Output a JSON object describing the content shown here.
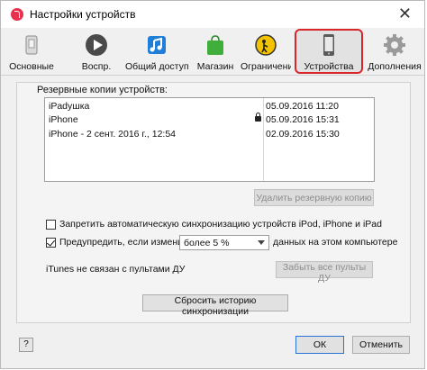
{
  "window": {
    "title": "Настройки устройств",
    "close_symbol": "✕"
  },
  "toolbar": {
    "items": [
      {
        "label": "Основные",
        "icon": "general-icon"
      },
      {
        "label": "Воспр.",
        "icon": "play-icon"
      },
      {
        "label": "Общий доступ",
        "icon": "sharing-icon"
      },
      {
        "label": "Магазин",
        "icon": "store-bag-icon"
      },
      {
        "label": "Ограничения",
        "icon": "restrictions-icon"
      },
      {
        "label": "Устройства",
        "icon": "phone-icon",
        "selected": true
      },
      {
        "label": "Дополнения",
        "icon": "gear-icon"
      }
    ]
  },
  "backups": {
    "label": "Резервные копии устройств:",
    "rows": [
      {
        "name": "iPadyшка",
        "date": "05.09.2016 11:20",
        "locked": false
      },
      {
        "name": "iPhone",
        "date": "05.09.2016 15:31",
        "locked": true
      },
      {
        "name": "iPhone - 2 сент. 2016 г., 12:54",
        "date": "02.09.2016 15:30",
        "locked": false
      }
    ],
    "delete_button": "Удалить резервную копию"
  },
  "options": {
    "prevent_sync_label": "Запретить автоматическую синхронизацию устройств iPod, iPhone и iPad",
    "warn_prefix": "Предупредить, если изменится",
    "warn_select_value": "более 5 %",
    "warn_suffix": "данных на этом компьютере",
    "remote_status": "iTunes не связан с пультами ДУ",
    "forget_remotes_button": "Забыть все пульты ДУ",
    "reset_history_button": "Сбросить историю синхронизации"
  },
  "footer": {
    "help": "?",
    "ok": "ОК",
    "cancel": "Отменить"
  },
  "colors": {
    "selection_outline": "#d9262b",
    "ok_border": "#2b72d7"
  }
}
